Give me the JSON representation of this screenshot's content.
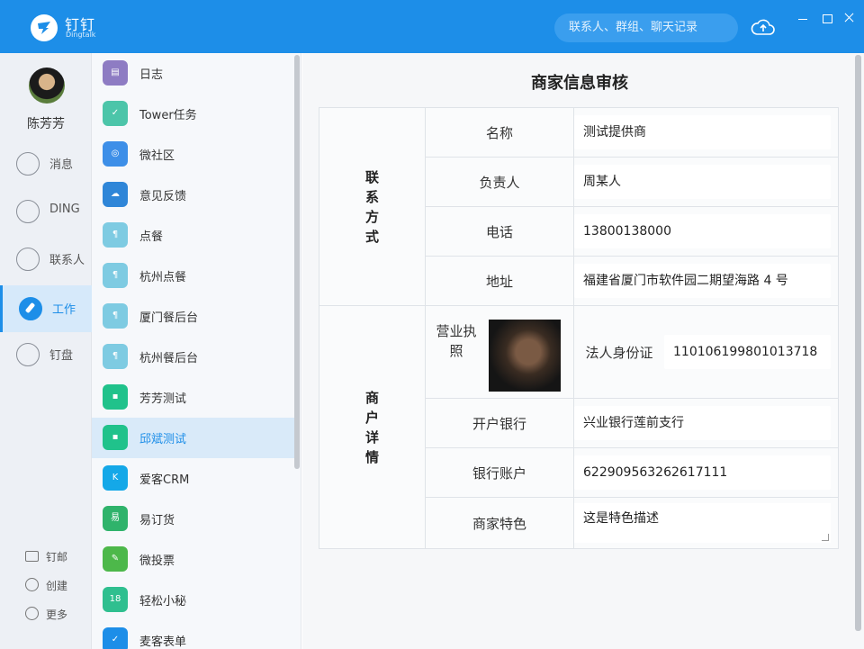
{
  "app": {
    "title": "钉钉",
    "subtitle": "Dingtalk"
  },
  "search": {
    "placeholder": "联系人、群组、聊天记录"
  },
  "user": {
    "name": "陈芳芳"
  },
  "nav": {
    "items": [
      {
        "label": "消息",
        "icon": "smile-icon"
      },
      {
        "label": "DING",
        "icon": "ding-icon"
      },
      {
        "label": "联系人",
        "icon": "contacts-icon"
      },
      {
        "label": "工作",
        "icon": "compass-icon"
      },
      {
        "label": "钉盘",
        "icon": "cloud-drive-icon"
      }
    ],
    "bottom": [
      {
        "label": "钉邮",
        "icon": "mail-icon"
      },
      {
        "label": "创建",
        "icon": "plus-circle-icon"
      },
      {
        "label": "更多",
        "icon": "more-icon"
      }
    ]
  },
  "apps": [
    {
      "name": "日志",
      "color": "#8e7cc3",
      "glyph": "▤"
    },
    {
      "name": "Tower任务",
      "color": "#4cc5a9",
      "glyph": "✓"
    },
    {
      "name": "微社区",
      "color": "#3d8fe8",
      "glyph": "◎"
    },
    {
      "name": "意见反馈",
      "color": "#2f86d8",
      "glyph": "☁"
    },
    {
      "name": "点餐",
      "color": "#7ecbe2",
      "glyph": "¶"
    },
    {
      "name": "杭州点餐",
      "color": "#7ecbe2",
      "glyph": "¶"
    },
    {
      "name": "厦门餐后台",
      "color": "#7ecbe2",
      "glyph": "¶"
    },
    {
      "name": "杭州餐后台",
      "color": "#7ecbe2",
      "glyph": "¶"
    },
    {
      "name": "芳芳测试",
      "color": "#20c28b",
      "glyph": "▪"
    },
    {
      "name": "邱斌测试",
      "color": "#20c28b",
      "glyph": "▪"
    },
    {
      "name": "爱客CRM",
      "color": "#14a8e8",
      "glyph": "K"
    },
    {
      "name": "易订货",
      "color": "#2fb36b",
      "glyph": "易"
    },
    {
      "name": "微投票",
      "color": "#4db84a",
      "glyph": "✎"
    },
    {
      "name": "轻松小秘",
      "color": "#2fbf8f",
      "glyph": "18"
    },
    {
      "name": "麦客表单",
      "color": "#1d8ee8",
      "glyph": "✓"
    }
  ],
  "page": {
    "title": "商家信息审核",
    "contact_section": "联系方式",
    "detail_section": "商户详情",
    "fields": {
      "name": {
        "label": "名称",
        "value": "测试提供商"
      },
      "manager": {
        "label": "负责人",
        "value": "周某人"
      },
      "phone": {
        "label": "电话",
        "value": "13800138000"
      },
      "address": {
        "label": "地址",
        "value": "福建省厦门市软件园二期望海路 4 号"
      },
      "license": {
        "label": "营业执照"
      },
      "id_card": {
        "label": "法人身份证",
        "value": "110106199801013718"
      },
      "bank": {
        "label": "开户银行",
        "value": "兴业银行莲前支行"
      },
      "account": {
        "label": "银行账户",
        "value": "622909563262617111"
      },
      "feature": {
        "label": "商家特色",
        "value": "这是特色描述"
      }
    }
  }
}
